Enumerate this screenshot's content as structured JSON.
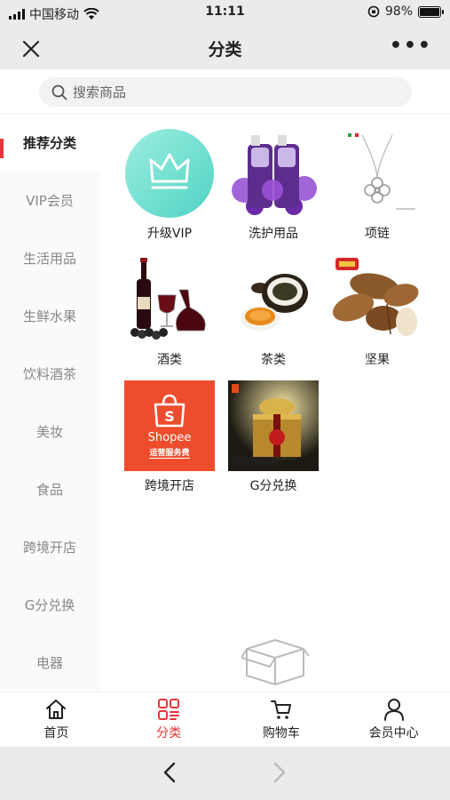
{
  "status_bar": {
    "carrier": "中国移动",
    "time": "11:11",
    "battery_percent": "98%",
    "battery_level": 0.98
  },
  "nav": {
    "title": "分类"
  },
  "search": {
    "placeholder": "搜索商品"
  },
  "sidebar": {
    "items": [
      {
        "label": "推荐分类",
        "active": true
      },
      {
        "label": "VIP会员"
      },
      {
        "label": "生活用品"
      },
      {
        "label": "生鲜水果"
      },
      {
        "label": "饮料酒茶"
      },
      {
        "label": "美妆"
      },
      {
        "label": "食品"
      },
      {
        "label": "跨境开店"
      },
      {
        "label": "G分兑换"
      },
      {
        "label": "电器"
      }
    ]
  },
  "grid": {
    "items": [
      {
        "label": "升级VIP",
        "icon": "crown-icon"
      },
      {
        "label": "洗护用品",
        "icon": "shampoo-bottles-image"
      },
      {
        "label": "项链",
        "icon": "necklace-image"
      },
      {
        "label": "酒类",
        "icon": "wine-image"
      },
      {
        "label": "茶类",
        "icon": "tea-image"
      },
      {
        "label": "坚果",
        "icon": "almond-image"
      },
      {
        "label": "跨境开店",
        "icon": "shopee-image",
        "badge_brand": "Shopee",
        "badge_sub": "运营服务费"
      },
      {
        "label": "G分兑换",
        "icon": "gift-box-image"
      }
    ]
  },
  "tabbar": {
    "items": [
      {
        "label": "首页",
        "icon": "home-icon"
      },
      {
        "label": "分类",
        "icon": "category-icon",
        "active": true
      },
      {
        "label": "购物车",
        "icon": "cart-icon"
      },
      {
        "label": "会员中心",
        "icon": "user-icon"
      }
    ]
  },
  "colors": {
    "accent": "#e8353b",
    "vip_circle": "#7fe0cf",
    "shopee_orange": "#ee4d2d"
  }
}
